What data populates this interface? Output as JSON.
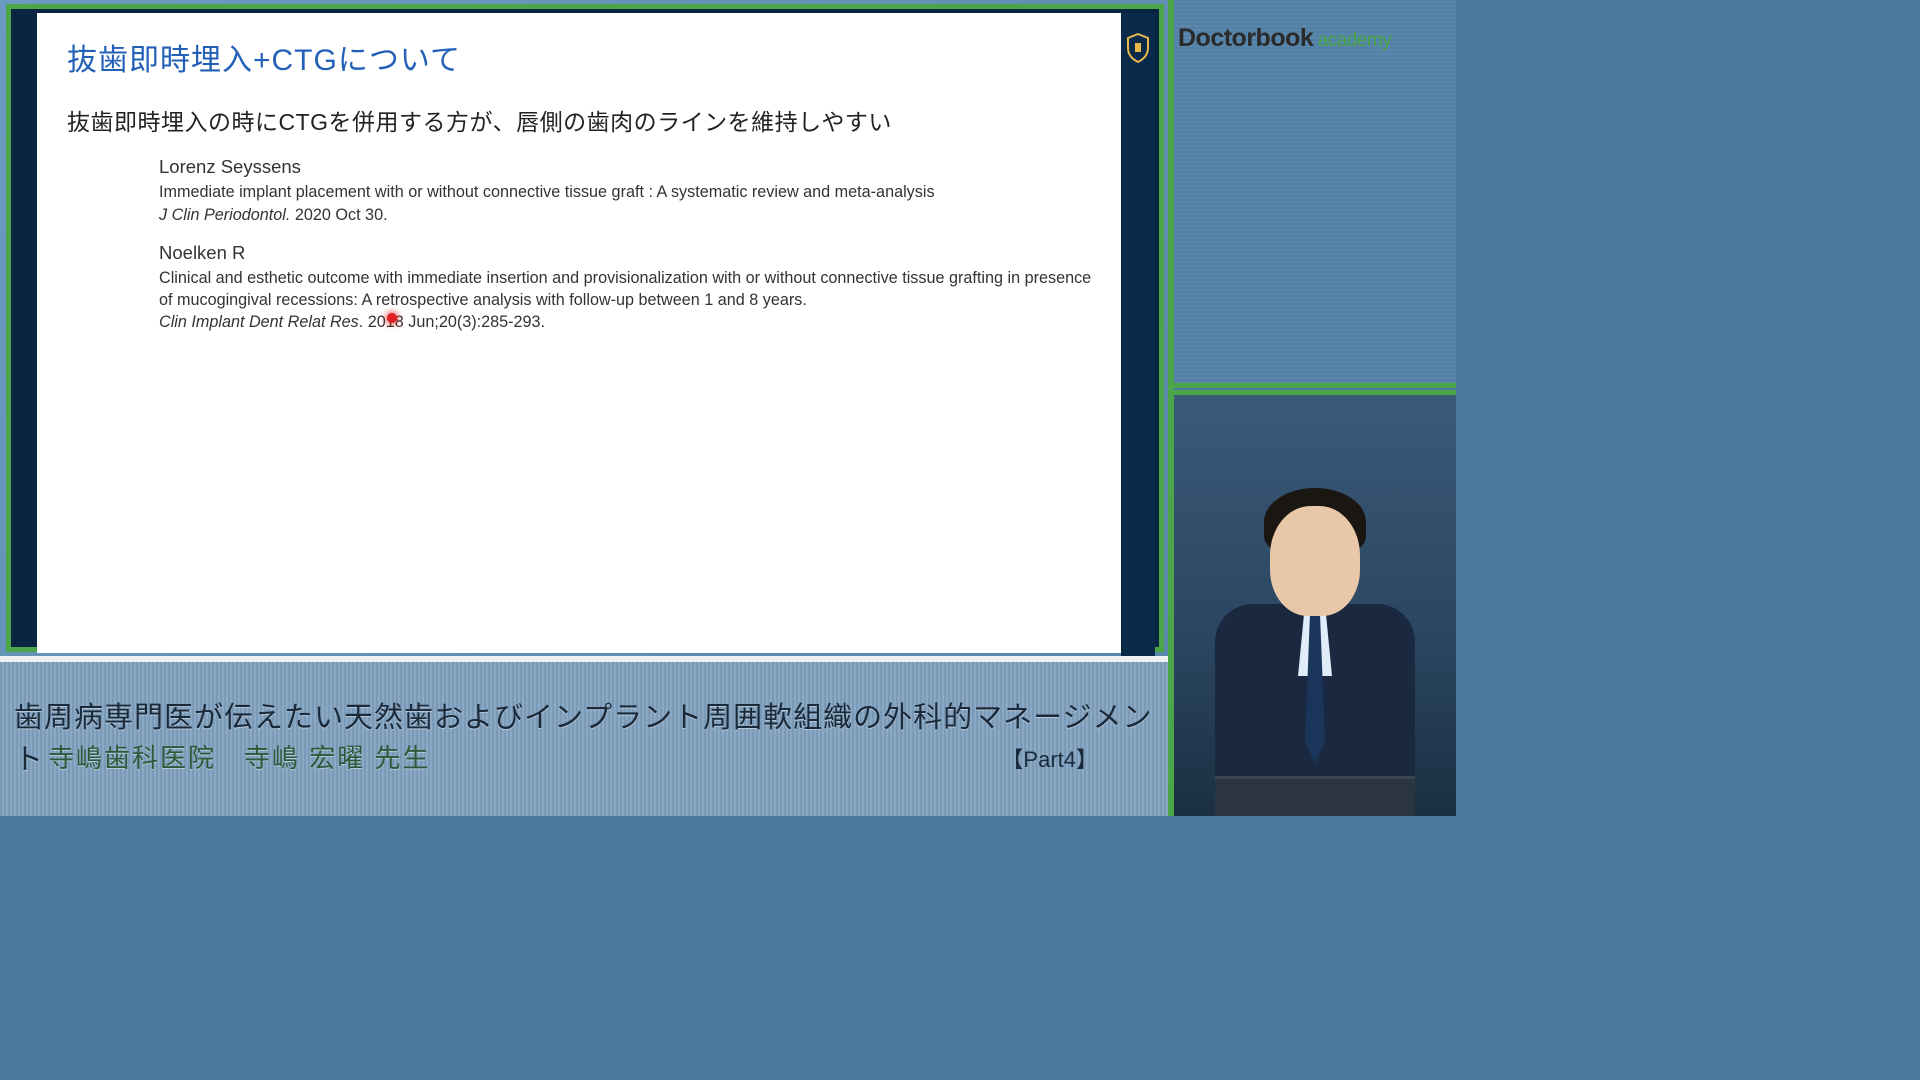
{
  "brand": {
    "name": "Doctorbook",
    "suffix": "academy"
  },
  "slide": {
    "title": "抜歯即時埋入+CTGについて",
    "subtitle": "抜歯即時埋入の時にCTGを併用する方が、唇側の歯肉のラインを維持しやすい",
    "refs": [
      {
        "author": "Lorenz Seyssens",
        "title": "Immediate implant placement with or without connective tissue graft   : A systematic review and meta-analysis",
        "journal": "J Clin Periodontol.",
        "rest": " 2020 Oct 30."
      },
      {
        "author": "Noelken R",
        "title": "Clinical and esthetic outcome with immediate insertion and provisionalization with or without connective tissue grafting in presence of mucogingival recessions: A retrospective analysis with follow-up between 1 and 8 years.",
        "journal": "Clin Implant Dent Relat Res",
        "rest": ". 2018 Jun;20(3):285-293."
      }
    ]
  },
  "footer": {
    "lecture_title": "歯周病専門医が伝えたい天然歯およびインプラント周囲軟組織の外科的マネージメント",
    "lecturer": "寺嶋歯科医院　寺嶋 宏曜 先生",
    "part": "【Part4】"
  }
}
